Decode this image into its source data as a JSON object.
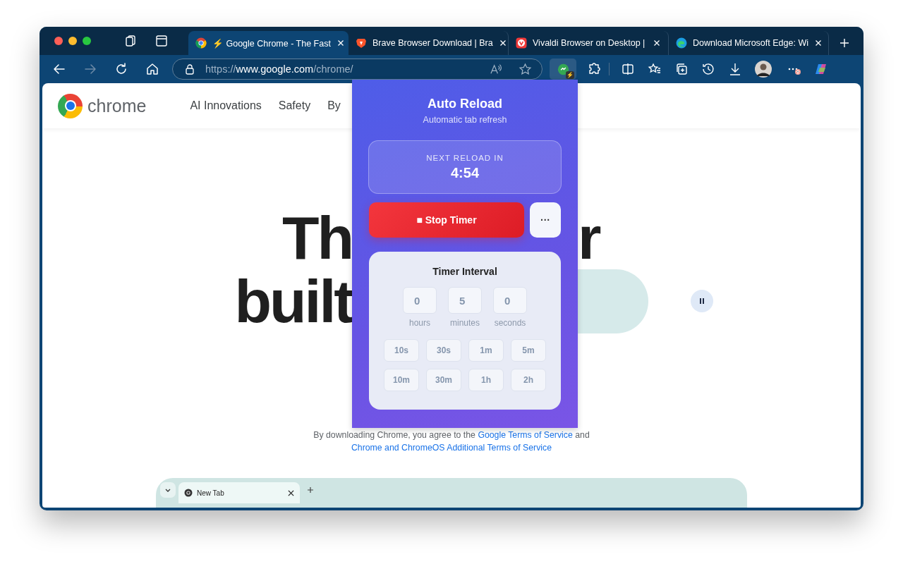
{
  "tabs": [
    {
      "title": "⚡ Google Chrome - The Fast",
      "kind": "chrome",
      "selected": true
    },
    {
      "title": "Brave Browser Download | Bra",
      "kind": "brave",
      "selected": false
    },
    {
      "title": "Vivaldi Browser on Desktop |",
      "kind": "vivaldi",
      "selected": false
    },
    {
      "title": "Download Microsoft Edge: Wi",
      "kind": "edge",
      "selected": false
    }
  ],
  "nav_buttons": [
    {
      "kind": "back",
      "disabled": false
    },
    {
      "kind": "forward",
      "disabled": true
    },
    {
      "kind": "reload",
      "disabled": false
    },
    {
      "kind": "home",
      "disabled": false
    }
  ],
  "address": {
    "scheme": "https://",
    "host": "www.google.com",
    "path": "/chrome/"
  },
  "extension": {
    "selected": true,
    "badge": "⚡"
  },
  "page": {
    "logo_text": "chrome",
    "nav": [
      "AI Innovations",
      "Safety",
      "By"
    ],
    "hero": {
      "line1_left": "Th",
      "line1_right": "r",
      "line2_left": "built"
    },
    "disclaimer": {
      "text": "By downloading Chrome, you agree to the ",
      "link1": "Google Terms of Service",
      "joiner": " and",
      "link2": "Chrome and ChromeOS Additional Terms of Service"
    },
    "preview": {
      "tab_title": "New Tab"
    }
  },
  "popup": {
    "title": "Auto Reload",
    "subtitle": "Automatic tab refresh",
    "countdown_label": "NEXT RELOAD IN",
    "countdown": "4:54",
    "stop_label": "■ Stop Timer",
    "more_label": "···",
    "interval_title": "Timer Interval",
    "fields": [
      {
        "value": "0",
        "unit": "hours"
      },
      {
        "value": "5",
        "unit": "minutes"
      },
      {
        "value": "0",
        "unit": "seconds"
      }
    ],
    "presets": [
      "10s",
      "30s",
      "1m",
      "5m",
      "10m",
      "30m",
      "1h",
      "2h"
    ]
  }
}
